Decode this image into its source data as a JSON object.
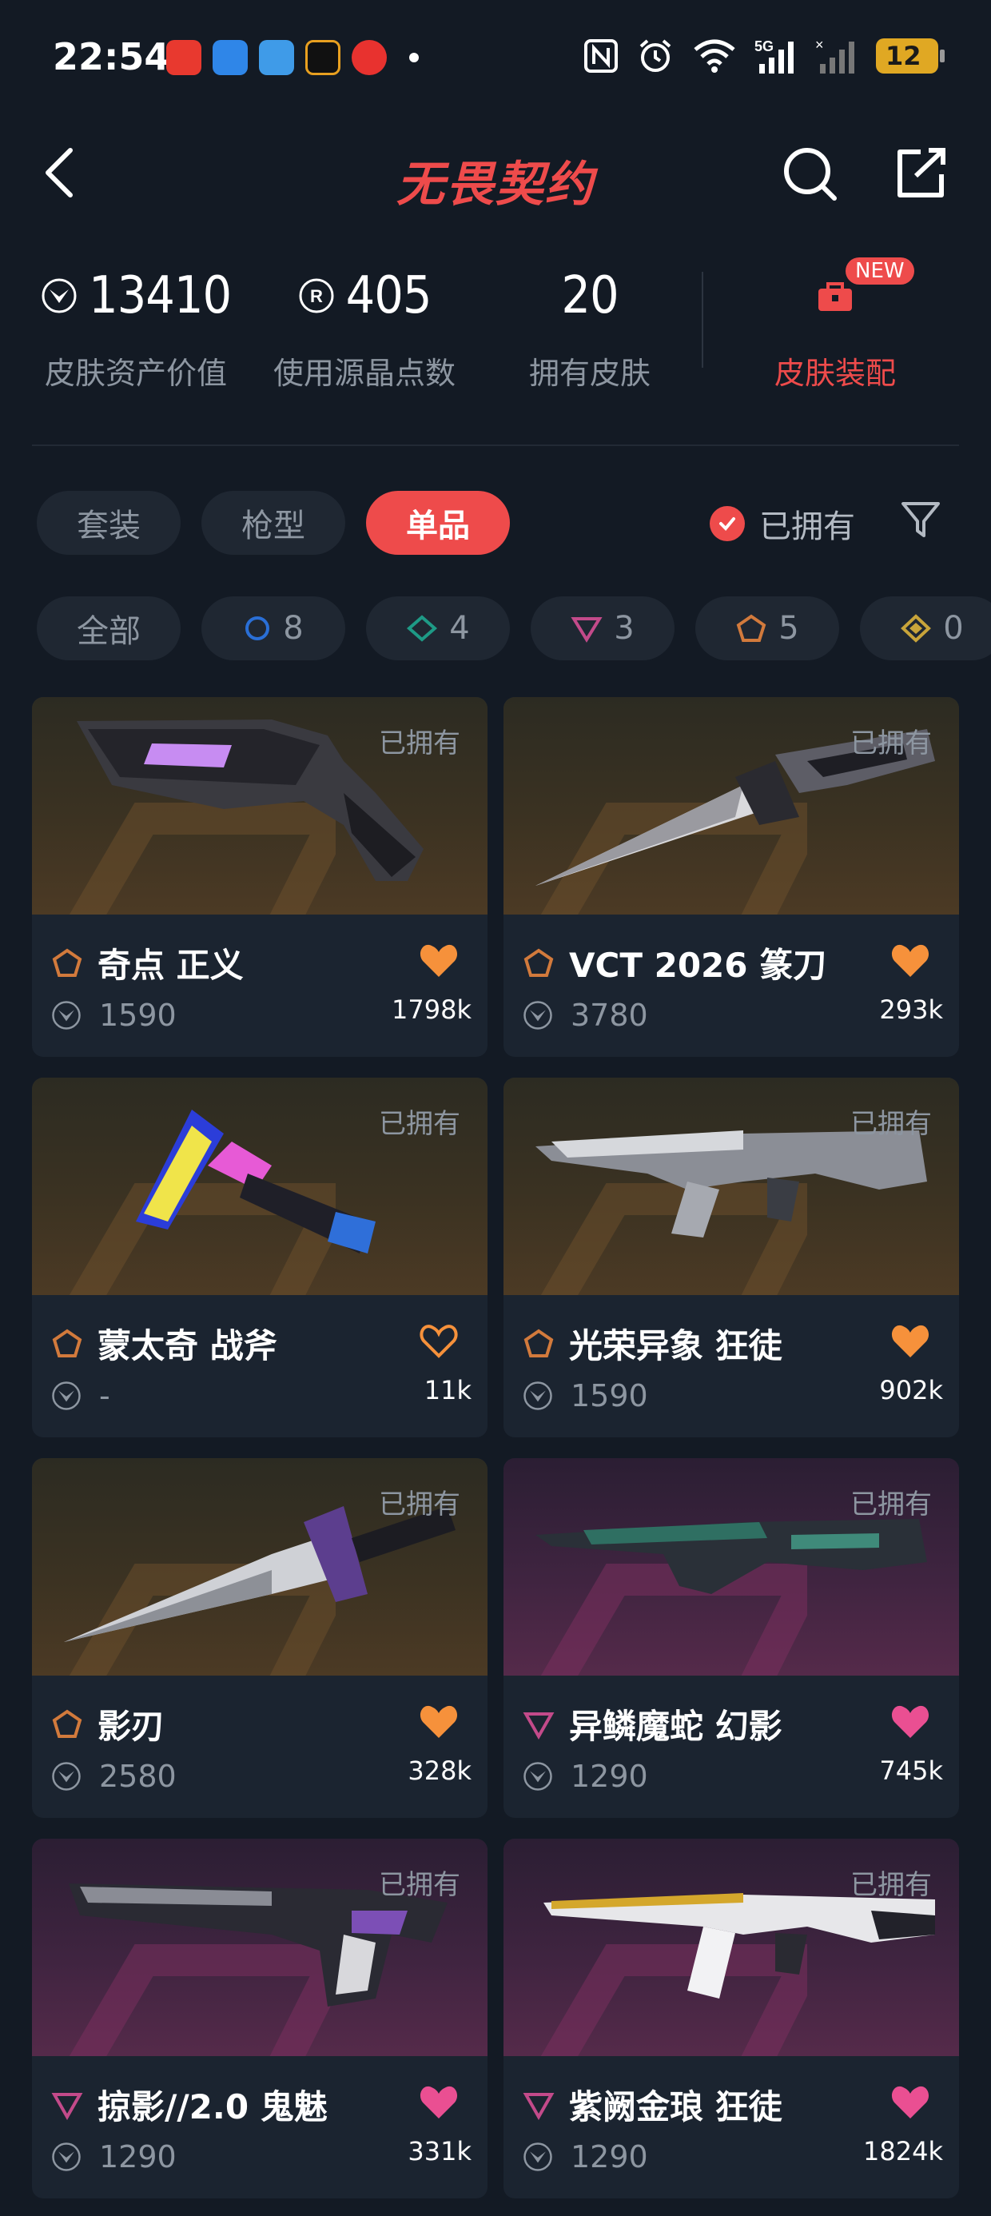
{
  "status_bar": {
    "time": "22:54",
    "notification_icons": [
      "tencent-map-icon",
      "qq-icon",
      "weather-icon",
      "app-icon",
      "netease-music-icon"
    ],
    "system_icons": [
      "nfc-icon",
      "alarm-icon",
      "wifi-icon",
      "signal-5g-icon",
      "signal-icon"
    ],
    "battery": "12"
  },
  "header": {
    "title": "无畏契约"
  },
  "stats": {
    "asset_value": "13410",
    "asset_value_label": "皮肤资产价值",
    "points_used": "405",
    "points_used_label": "使用源晶点数",
    "owned_count": "20",
    "owned_count_label": "拥有皮肤",
    "equip_badge": "NEW",
    "equip_label": "皮肤装配"
  },
  "tabs": [
    "套装",
    "枪型",
    "单品"
  ],
  "active_tab": "单品",
  "owned_filter_label": "已拥有",
  "tier_chips": [
    {
      "label": "全部",
      "count": ""
    },
    {
      "label": "",
      "count": "8",
      "tier": "select",
      "color": "#2a6fd6"
    },
    {
      "label": "",
      "count": "4",
      "tier": "deluxe",
      "color": "#1e9a86"
    },
    {
      "label": "",
      "count": "3",
      "tier": "premium",
      "color": "#c34a8a"
    },
    {
      "label": "",
      "count": "5",
      "tier": "exclusive",
      "color": "#d27a3c"
    },
    {
      "label": "",
      "count": "0",
      "tier": "ultra",
      "color": "#c8a43a"
    }
  ],
  "colors": {
    "accent": "#ee4b4b",
    "heart_orange": "#f6913b",
    "heart_pink": "#ea4f92",
    "tier_exclusive": "#d27a3c",
    "tier_premium": "#c34a8a"
  },
  "cards": [
    {
      "name": "奇点 正义",
      "price": "1590",
      "likes": "1798k",
      "owned_tag": "已拥有",
      "tier": "exclusive",
      "bg": "gold",
      "liked": true
    },
    {
      "name": "VCT 2026 篆刀",
      "price": "3780",
      "likes": "293k",
      "owned_tag": "已拥有",
      "tier": "exclusive",
      "bg": "gold",
      "liked": true
    },
    {
      "name": "蒙太奇 战斧",
      "price": "-",
      "likes": "11k",
      "owned_tag": "已拥有",
      "tier": "exclusive",
      "bg": "gold",
      "liked": false
    },
    {
      "name": "光荣异象 狂徒",
      "price": "1590",
      "likes": "902k",
      "owned_tag": "已拥有",
      "tier": "exclusive",
      "bg": "gold",
      "liked": true
    },
    {
      "name": "影刃",
      "price": "2580",
      "likes": "328k",
      "owned_tag": "已拥有",
      "tier": "exclusive",
      "bg": "gold",
      "liked": true
    },
    {
      "name": "异鳞魔蛇 幻影",
      "price": "1290",
      "likes": "745k",
      "owned_tag": "已拥有",
      "tier": "premium",
      "bg": "purple",
      "liked": true
    },
    {
      "name": "掠影//2.0 鬼魅",
      "price": "1290",
      "likes": "331k",
      "owned_tag": "已拥有",
      "tier": "premium",
      "bg": "purple",
      "liked": true
    },
    {
      "name": "紫阙金琅 狂徒",
      "price": "1290",
      "likes": "1824k",
      "owned_tag": "已拥有",
      "tier": "premium",
      "bg": "purple",
      "liked": true
    }
  ]
}
